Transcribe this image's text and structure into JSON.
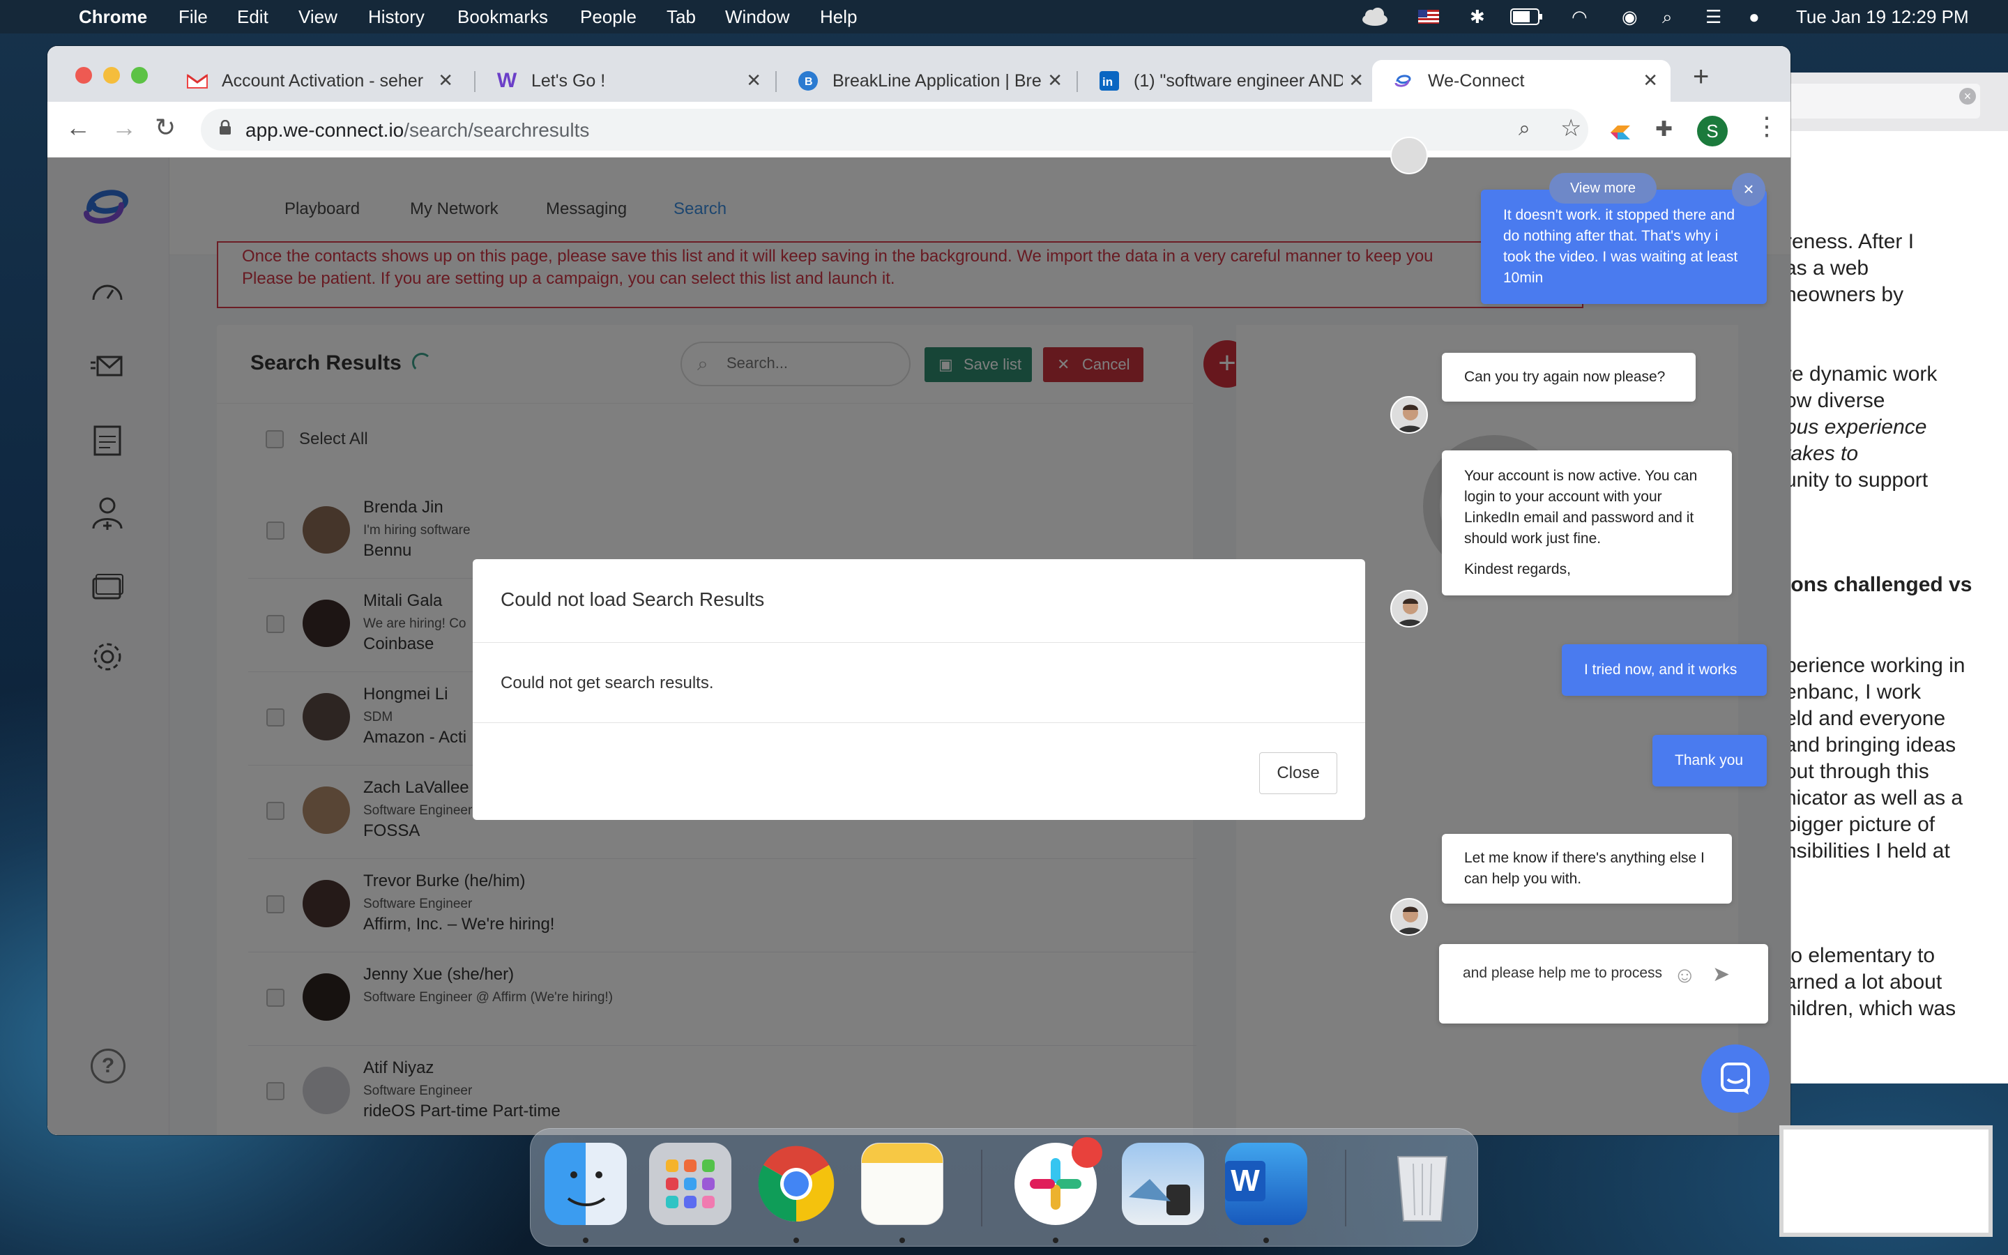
{
  "menubar": {
    "app": "Chrome",
    "items": [
      "File",
      "Edit",
      "View",
      "History",
      "Bookmarks",
      "People",
      "Tab",
      "Window",
      "Help"
    ],
    "clock": "Tue Jan 19  12:29 PM"
  },
  "tabs": [
    {
      "title": "Account Activation - seher",
      "icon": "gmail-icon",
      "active": false
    },
    {
      "title": "Let's Go !",
      "icon": "w-logo-icon",
      "active": false
    },
    {
      "title": "BreakLine Application | Bre",
      "icon": "breakline-icon",
      "active": false
    },
    {
      "title": "(1) \"software engineer AND",
      "icon": "linkedin-icon",
      "active": false
    },
    {
      "title": "We-Connect",
      "icon": "weconnect-icon",
      "active": true
    }
  ],
  "address": {
    "host": "app.we-connect.io",
    "path": "/search/searchresults"
  },
  "profile_initial": "S",
  "nav": {
    "items": [
      "Playboard",
      "My Network",
      "Messaging",
      "Search"
    ],
    "active": "Search"
  },
  "warning": {
    "line1": "Once the contacts shows up on this page, please save this list and it will keep saving in the background. We import the data in a very careful manner to keep you",
    "line2": "Please be patient. If you are setting up a campaign, you can select this list and launch it."
  },
  "results": {
    "title": "Search Results",
    "search_placeholder": "Search...",
    "save_label": "Save list",
    "cancel_label": "Cancel",
    "select_all": "Select All",
    "rows": [
      {
        "name": "Brenda Jin",
        "headline": "I'm hiring software",
        "company": "Bennu"
      },
      {
        "name": "Mitali Gala",
        "headline": "We are hiring! Co",
        "company": "Coinbase"
      },
      {
        "name": "Hongmei Li",
        "headline": "SDM",
        "company": "Amazon - Acti"
      },
      {
        "name": "Zach LaVallee",
        "headline": "Software Engineer -- We're Hiring!",
        "company": "FOSSA"
      },
      {
        "name": "Trevor Burke (he/him)",
        "headline": "Software Engineer",
        "company": "Affirm, Inc. – We're hiring!"
      },
      {
        "name": "Jenny Xue (she/her)",
        "headline": "Software Engineer @ Affirm (We're hiring!)",
        "company": ""
      },
      {
        "name": "Atif Niyaz",
        "headline": "Software Engineer",
        "company": "rideOS Part-time Part-time"
      }
    ]
  },
  "modal": {
    "title": "Could not load Search Results",
    "body": "Could not get search results.",
    "close": "Close"
  },
  "chat": {
    "view_more": "View more",
    "close_symbol": "×",
    "m1": "It doesn't work. it stopped there and do nothing after that. That's why i took the video. I was waiting at least 10min",
    "m2": "Can you try again now please?",
    "m3": "Your account is now active. You can login to your account with your LinkedIn email and password and it should work just fine.",
    "m3b": "Kindest regards,",
    "m4": "I tried now, and it works",
    "m5": "Thank you",
    "m6": "Let me know if there's anything else I can help you with.",
    "draft": "and please help me to process"
  },
  "doc_lines": [
    {
      "t": "reness. After I",
      "s": "n"
    },
    {
      "t": "as a web",
      "s": "n"
    },
    {
      "t": "neowners by",
      "s": "n"
    },
    {
      "t": "re dynamic work",
      "s": "n"
    },
    {
      "t": "ow diverse",
      "s": "n"
    },
    {
      "t": "ous experience",
      "s": "i"
    },
    {
      "t": "takes to",
      "s": "i"
    },
    {
      "t": "unity to support",
      "s": "n"
    },
    {
      "t": "ions challenged vs",
      "s": "b"
    },
    {
      "t": "perience working in",
      "s": "n"
    },
    {
      "t": "enbanc, I work",
      "s": "n"
    },
    {
      "t": "eld and everyone",
      "s": "n"
    },
    {
      "t": "and bringing ideas",
      "s": "n"
    },
    {
      "t": "out through this",
      "s": "n"
    },
    {
      "t": "nicator as well as a",
      "s": "n"
    },
    {
      "t": "bigger picture of",
      "s": "n"
    },
    {
      "t": "nsibilities I held at",
      "s": "n"
    },
    {
      "t": "to elementary to",
      "s": "n"
    },
    {
      "t": "arned a lot about",
      "s": "n"
    },
    {
      "t": "hildren, which was",
      "s": "n"
    }
  ],
  "dock": [
    "Finder",
    "Launchpad",
    "Chrome",
    "Notes",
    "Slack",
    "Preview",
    "Word",
    "Trash"
  ],
  "colors": {
    "accent": "#4a7bef",
    "danger": "#cf2e3b",
    "save": "#2f8a6e",
    "link": "#3b8ddf"
  }
}
